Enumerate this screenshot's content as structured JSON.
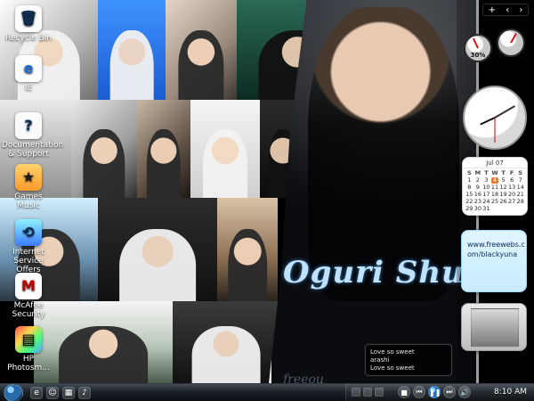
{
  "desktop": {
    "icons": [
      {
        "name": "recycle-bin",
        "label": "Recycle Bin"
      },
      {
        "name": "ie",
        "label": "IE"
      },
      {
        "name": "documentation-support",
        "label": "Documentation & Support"
      },
      {
        "name": "games",
        "label": "Games"
      },
      {
        "name": "music",
        "label": "Music"
      },
      {
        "name": "internet-service-offers",
        "label": "Internet Service Offers"
      },
      {
        "name": "mcafee-security",
        "label": "McAfee Security"
      },
      {
        "name": "hp-photosmart",
        "label": "HP Photosm..."
      }
    ]
  },
  "wallpaper": {
    "title": "Oguri Shun",
    "bottom_text": "freeou"
  },
  "gadgets": {
    "meters": [
      {
        "name": "cpu-meter",
        "readout": "30%"
      },
      {
        "name": "memory-meter",
        "readout": ""
      }
    ],
    "calendar": {
      "month_label": "Jul 07",
      "days_of_week": [
        "S",
        "M",
        "T",
        "W",
        "T",
        "F",
        "S"
      ],
      "weeks": [
        [
          "1",
          "2",
          "3",
          "4",
          "5",
          "6",
          "7"
        ],
        [
          "8",
          "9",
          "10",
          "11",
          "12",
          "13",
          "14"
        ],
        [
          "15",
          "16",
          "17",
          "18",
          "19",
          "20",
          "21"
        ],
        [
          "22",
          "23",
          "24",
          "25",
          "26",
          "27",
          "28"
        ],
        [
          "29",
          "30",
          "31",
          "",
          "",
          "",
          ""
        ]
      ],
      "highlight_day": "4"
    },
    "note_text": "www.freewebs.c\nom/blackyuna"
  },
  "media_popup": {
    "line1": "Love so sweet",
    "line2": "arashi",
    "line3": "Love so sweet"
  },
  "taskbar": {
    "clock": "8:10 AM"
  }
}
